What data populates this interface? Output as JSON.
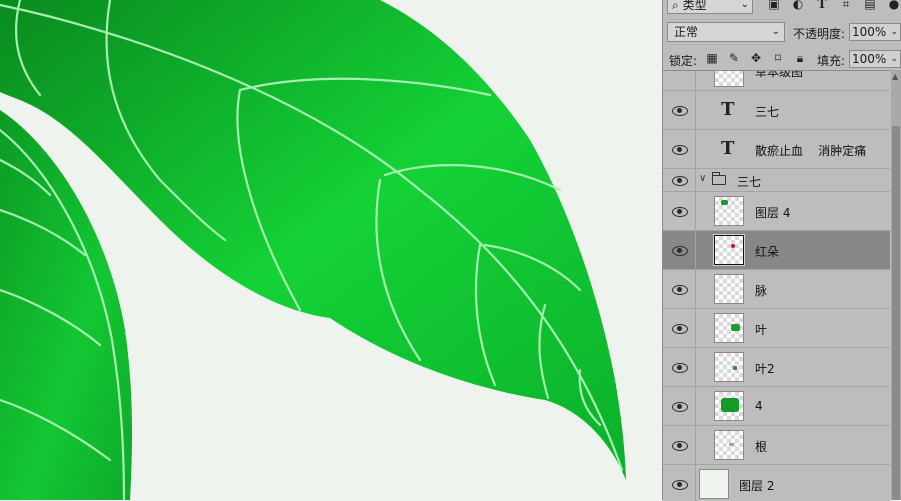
{
  "colors": {
    "canvas_bg": "#eef3ee",
    "leaf_dark": "#0a8f1f",
    "leaf_light": "#14d236",
    "vein": "#a6efb0",
    "panel_bg": "#bdbdbd",
    "selected_row": "#878787"
  },
  "layers_panel": {
    "filter_label": "类型",
    "blend_mode": "正常",
    "opacity_label": "不透明度:",
    "opacity_value": "100%",
    "lock_label": "锁定:",
    "fill_label": "填充:",
    "fill_value": "100%",
    "icons": [
      "search-icon",
      "image-filter-icon",
      "adjustment-filter-icon",
      "type-filter-icon",
      "shape-filter-icon",
      "smart-object-filter-icon",
      "toggle-filter-icon"
    ],
    "lock_icons": [
      "lock-transparency-icon",
      "lock-paint-icon",
      "lock-position-icon",
      "lock-artboard-icon",
      "lock-all-icon"
    ],
    "layers": [
      {
        "name": "草本级图",
        "kind": "image",
        "partial": true
      },
      {
        "name": "三七",
        "kind": "text"
      },
      {
        "name": "散瘀止血    消肿定痛",
        "kind": "text"
      },
      {
        "name": "三七",
        "kind": "group"
      },
      {
        "name": "图层 4",
        "kind": "image",
        "indent": true,
        "mark": "green"
      },
      {
        "name": "红朵",
        "kind": "image",
        "indent": true,
        "selected": true,
        "mark": "red"
      },
      {
        "name": "脉",
        "kind": "image",
        "indent": true
      },
      {
        "name": "叶",
        "kind": "image",
        "indent": true,
        "mark": "green"
      },
      {
        "name": "叶2",
        "kind": "image",
        "indent": true,
        "mark": "green-small"
      },
      {
        "name": "4",
        "kind": "image",
        "indent": true,
        "mark": "green-big"
      },
      {
        "name": "根",
        "kind": "image",
        "indent": true,
        "mark": "tan"
      },
      {
        "name": "图层 2",
        "kind": "image",
        "mark": "plain"
      }
    ]
  }
}
